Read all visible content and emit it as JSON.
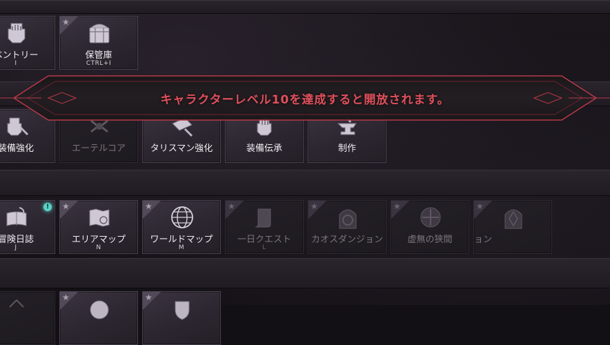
{
  "colors": {
    "accent_red": "#e0505c",
    "badge_cyan": "#5ad2c6"
  },
  "unlock_message": "キャラクターレベル10を達成すると開放されます。",
  "rows": [
    {
      "tiles": [
        {
          "label": "ベントリー",
          "key": "I",
          "icon": "gauntlet-icon",
          "enabled": true,
          "star": false
        },
        {
          "label": "保管庫",
          "key": "CTRL+I",
          "icon": "storage-chest-icon",
          "enabled": true,
          "star": true
        }
      ]
    },
    {
      "tiles": [
        {
          "label": "装備強化",
          "key": "",
          "icon": "gauntlet-hammer-icon",
          "enabled": true,
          "star": false
        },
        {
          "label": "エーテルコア",
          "key": "",
          "icon": "ether-core-icon",
          "enabled": false,
          "star": false
        },
        {
          "label": "タリスマン強化",
          "key": "",
          "icon": "talisman-icon",
          "enabled": true,
          "star": false
        },
        {
          "label": "装備伝承",
          "key": "",
          "icon": "gauntlet-transfer-icon",
          "enabled": true,
          "star": false
        },
        {
          "label": "制作",
          "key": "",
          "icon": "anvil-icon",
          "enabled": true,
          "star": false
        }
      ]
    },
    {
      "tiles": [
        {
          "label": "冒険日誌",
          "key": "J",
          "icon": "journal-quill-icon",
          "enabled": true,
          "star": false,
          "badge": "!"
        },
        {
          "label": "エリアマップ",
          "key": "N",
          "icon": "area-map-icon",
          "enabled": true,
          "star": true
        },
        {
          "label": "ワールドマップ",
          "key": "M",
          "icon": "globe-icon",
          "enabled": true,
          "star": true
        },
        {
          "label": "一日クエスト",
          "key": "L",
          "icon": "scroll-icon",
          "enabled": false,
          "star": true
        },
        {
          "label": "カオスダンジョン",
          "key": "",
          "icon": "chaos-portal-icon",
          "enabled": false,
          "star": true
        },
        {
          "label": "虚無の狭間",
          "key": "",
          "icon": "void-sigil-icon",
          "enabled": false,
          "star": true
        },
        {
          "label": "ョン",
          "key": "",
          "icon": "gate-icon",
          "enabled": false,
          "star": true
        }
      ]
    },
    {
      "tiles": [
        {
          "label": "",
          "key": "",
          "icon": "partial-icon",
          "enabled": true,
          "star": false
        },
        {
          "label": "",
          "key": "",
          "icon": "round-emblem-icon",
          "enabled": true,
          "star": true
        },
        {
          "label": "",
          "key": "",
          "icon": "shield-emblem-icon",
          "enabled": true,
          "star": true
        }
      ]
    }
  ]
}
